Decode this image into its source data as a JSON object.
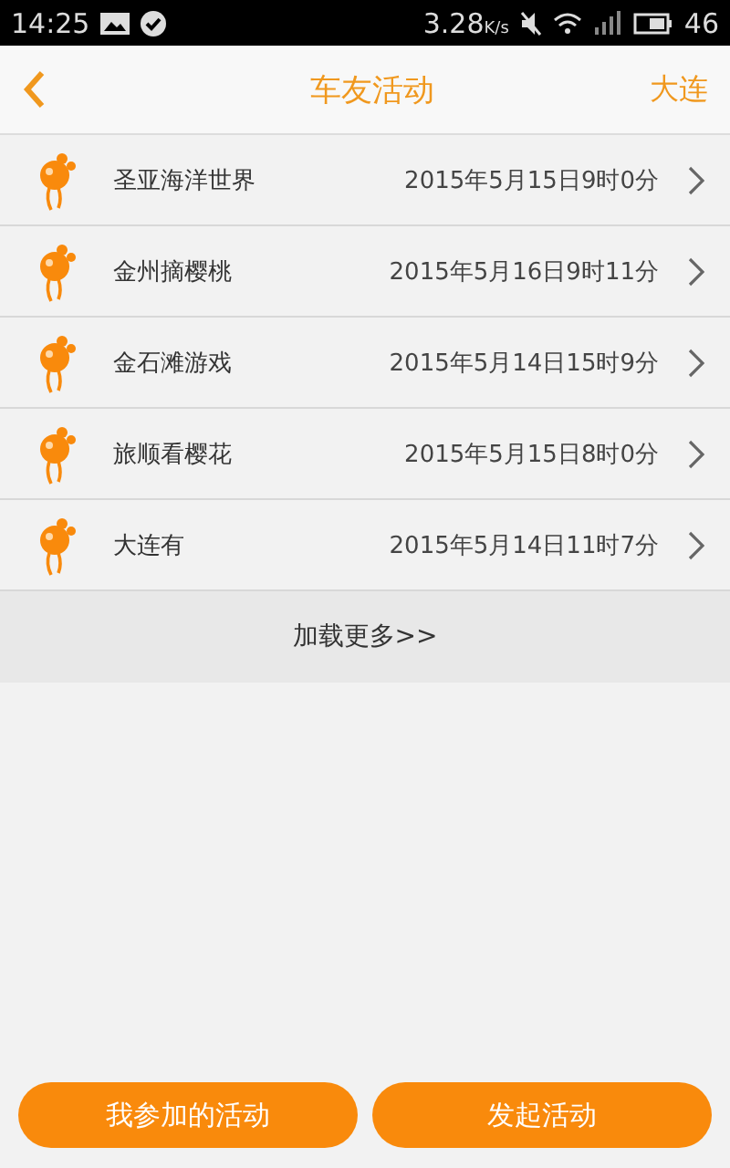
{
  "status_bar": {
    "time": "14:25",
    "speed": "3.28",
    "speed_unit": "K/s",
    "network": "46"
  },
  "header": {
    "title": "车友活动",
    "city": "大连"
  },
  "activities": [
    {
      "name": "圣亚海洋世界",
      "time": "2015年5月15日9时0分"
    },
    {
      "name": "金州摘樱桃",
      "time": "2015年5月16日9时11分"
    },
    {
      "name": "金石滩游戏",
      "time": "2015年5月14日15时9分"
    },
    {
      "name": "旅顺看樱花",
      "time": "2015年5月15日8时0分"
    },
    {
      "name": "大连有",
      "time": "2015年5月14日11时7分"
    }
  ],
  "load_more": "加载更多>>",
  "buttons": [
    "我参加的活动",
    "发起活动"
  ]
}
